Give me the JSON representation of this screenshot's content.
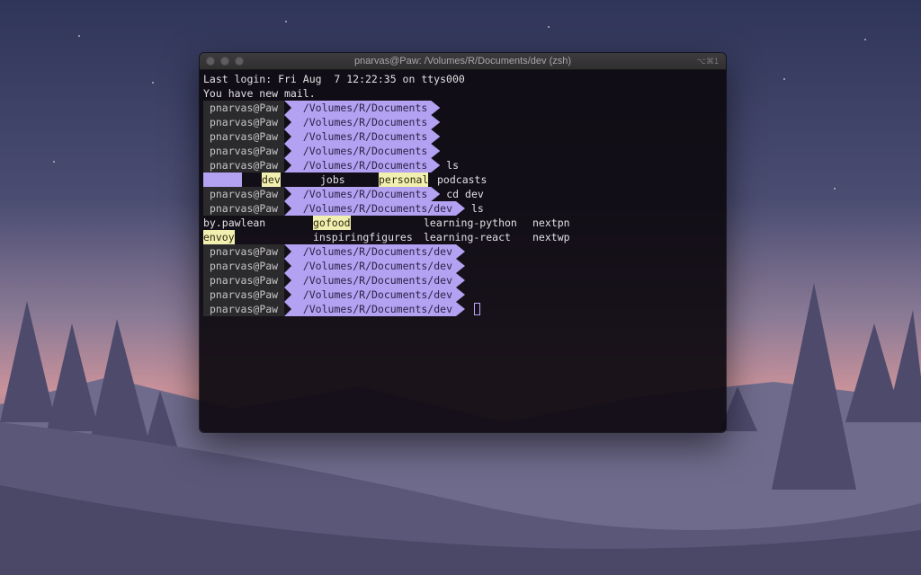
{
  "window": {
    "title": "pnarvas@Paw: /Volumes/R/Documents/dev (zsh)",
    "shortcut": "⌥⌘1"
  },
  "terminal": {
    "last_login": "Last login: Fri Aug  7 12:22:35 on ttys000",
    "mail": "You have new mail.",
    "user": "pnarvas@Paw",
    "path_docs": "/Volumes/R/Documents",
    "path_dev": "/Volumes/R/Documents/dev",
    "cmd_ls": "ls",
    "cmd_cd": "cd dev",
    "ls_docs": [
      "dev",
      "jobs",
      "personal",
      "podcasts"
    ],
    "ls_dev": [
      "by.pawlean",
      "gofood",
      "learning-python",
      "nextpn",
      "envoy",
      "inspiringfigures",
      "learning-react",
      "nextwp"
    ]
  },
  "colors": {
    "accent": "#b3a1f1",
    "highlight": "#f2f0b0",
    "terminal_bg": "#0e0a10"
  }
}
